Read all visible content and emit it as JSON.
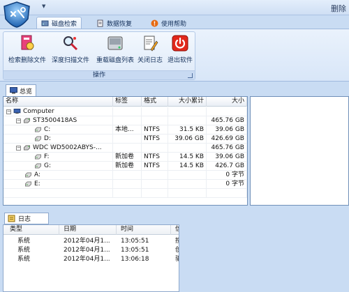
{
  "window": {
    "title": "删除"
  },
  "tabs": [
    {
      "label": "磁盘检索",
      "active": true
    },
    {
      "label": "数据恢复",
      "active": false
    },
    {
      "label": "使用帮助",
      "active": false
    }
  ],
  "ribbon": {
    "buttons": [
      {
        "label": "检索删除文件",
        "icon": "delete-file-search-icon"
      },
      {
        "label": "深度扫描文件",
        "icon": "deep-scan-icon"
      },
      {
        "label": "重载磁盘列表",
        "icon": "disk-reload-icon"
      },
      {
        "label": "关闭日志",
        "icon": "close-log-icon"
      },
      {
        "label": "退出软件",
        "icon": "power-icon"
      }
    ],
    "group_label": "操作"
  },
  "summary_tab": {
    "label": "总览"
  },
  "table": {
    "columns": [
      "名称",
      "标签",
      "格式",
      "大小累计",
      "大小"
    ],
    "rows": [
      {
        "level": 0,
        "expand": "−",
        "icon": "computer-icon",
        "name": "Computer",
        "label": "",
        "format": "",
        "cumulative": "",
        "size": ""
      },
      {
        "level": 1,
        "expand": "−",
        "icon": "hdd-icon",
        "name": "ST3500418AS",
        "label": "",
        "format": "",
        "cumulative": "",
        "size": "465.76 GB"
      },
      {
        "level": 2,
        "expand": "",
        "icon": "drive-icon",
        "name": "C:",
        "label": "本地...",
        "format": "NTFS",
        "cumulative": "31.5 KB",
        "size": "39.06 GB"
      },
      {
        "level": 2,
        "expand": "",
        "icon": "drive-icon",
        "name": "D:",
        "label": "",
        "format": "NTFS",
        "cumulative": "39.06 GB",
        "size": "426.69 GB"
      },
      {
        "level": 1,
        "expand": "−",
        "icon": "hdd-icon",
        "name": "WDC  WD5002ABYS-...",
        "label": "",
        "format": "",
        "cumulative": "",
        "size": "465.76 GB"
      },
      {
        "level": 2,
        "expand": "",
        "icon": "drive-icon",
        "name": "F:",
        "label": "新加卷",
        "format": "NTFS",
        "cumulative": "14.5 KB",
        "size": "39.06 GB"
      },
      {
        "level": 2,
        "expand": "",
        "icon": "drive-icon",
        "name": "G:",
        "label": "新加卷",
        "format": "NTFS",
        "cumulative": "14.5 KB",
        "size": "426.7 GB"
      },
      {
        "level": 1,
        "expand": "",
        "icon": "drive-icon",
        "name": "A:",
        "label": "",
        "format": "",
        "cumulative": "",
        "size": "0 字节"
      },
      {
        "level": 1,
        "expand": "",
        "icon": "drive-icon",
        "name": "E:",
        "label": "",
        "format": "",
        "cumulative": "",
        "size": "0 字节"
      }
    ]
  },
  "log": {
    "tab_label": "日志",
    "columns": [
      "类型",
      "日期",
      "时间",
      "信"
    ],
    "rows": [
      {
        "type": "系统",
        "date": "2012年04月1...",
        "time": "13:05:51",
        "msg": "搜"
      },
      {
        "type": "系统",
        "date": "2012年04月1...",
        "time": "13:05:51",
        "msg": "创"
      },
      {
        "type": "系统",
        "date": "2012年04月1...",
        "time": "13:06:18",
        "msg": "驱"
      }
    ]
  }
}
